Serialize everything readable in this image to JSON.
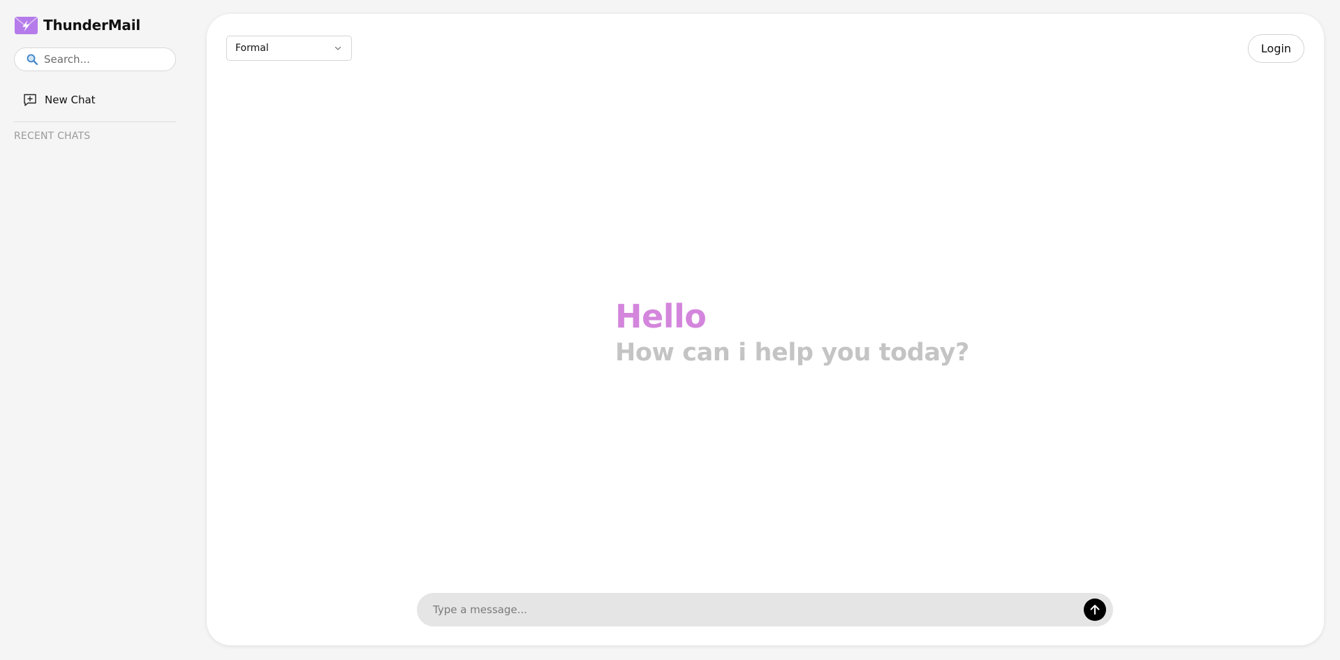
{
  "brand": {
    "name": "ThunderMail",
    "logo_icon": "envelope-lightning-icon",
    "logo_color": "#b57bea"
  },
  "sidebar": {
    "search": {
      "placeholder": "Search...",
      "icon": "search-icon",
      "icon_color": "#3b82c4"
    },
    "new_chat": {
      "label": "New Chat",
      "icon": "message-plus-icon"
    },
    "recent_label": "RECENT CHATS"
  },
  "header": {
    "tone_select": {
      "value": "Formal",
      "icon": "chevron-down-icon"
    },
    "login_label": "Login"
  },
  "greeting": {
    "hello": "Hello",
    "hello_color": "#d386dc",
    "subtitle": "How can i help you today?",
    "subtitle_color": "#c4c4c4"
  },
  "composer": {
    "placeholder": "Type a message...",
    "send_icon": "arrow-up-icon",
    "send_color": "#000000"
  },
  "colors": {
    "page_background": "#f5f5f5",
    "card_background": "#ffffff",
    "composer_background": "#e5e5e5"
  }
}
